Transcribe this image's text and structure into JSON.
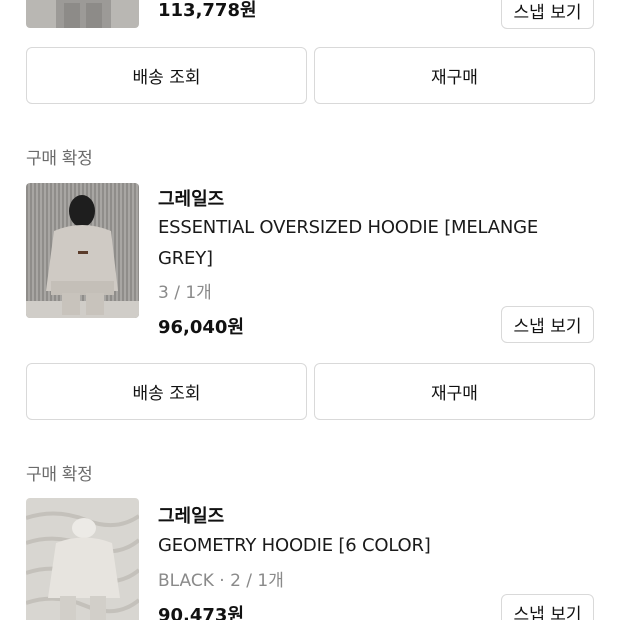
{
  "orders": [
    {
      "price": "113,778원",
      "snap_label": "스냅 보기",
      "actions": {
        "delivery": "배송 조회",
        "reorder": "재구매"
      }
    },
    {
      "status": "구매 확정",
      "brand": "그레일즈",
      "name": "ESSENTIAL OVERSIZED HOODIE [MELANGE GREY]",
      "option": "3 / 1개",
      "price": "96,040원",
      "snap_label": "스냅 보기",
      "actions": {
        "delivery": "배송 조회",
        "reorder": "재구매"
      }
    },
    {
      "status": "구매 확정",
      "brand": "그레일즈",
      "name": "GEOMETRY HOODIE [6 COLOR]",
      "option": "BLACK · 2 / 1개",
      "price": "90,473원",
      "snap_label": "스냅 보기"
    }
  ]
}
